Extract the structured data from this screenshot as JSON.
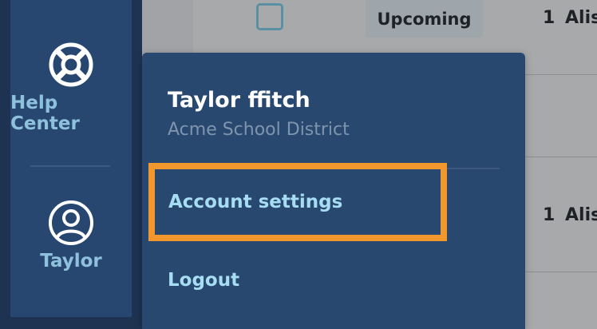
{
  "table": {
    "row1": {
      "status": "Upcoming",
      "count": "1",
      "name": "Alis"
    },
    "row2": {
      "count": "1",
      "name": "Alis"
    }
  },
  "sidebar": {
    "items": [
      {
        "label": "Help Center",
        "icon": "lifebuoy-icon"
      },
      {
        "label": "Taylor",
        "icon": "user-avatar-icon"
      }
    ]
  },
  "account_menu": {
    "user_name": "Taylor ffitch",
    "organization": "Acme School District",
    "items": [
      {
        "label": "Account settings",
        "highlighted": true
      },
      {
        "label": "Logout"
      }
    ]
  },
  "colors": {
    "sidebar_bg": "#284770",
    "menu_bg": "#284870",
    "link_text": "#a6ddf2",
    "highlight_border": "#f2962e"
  }
}
